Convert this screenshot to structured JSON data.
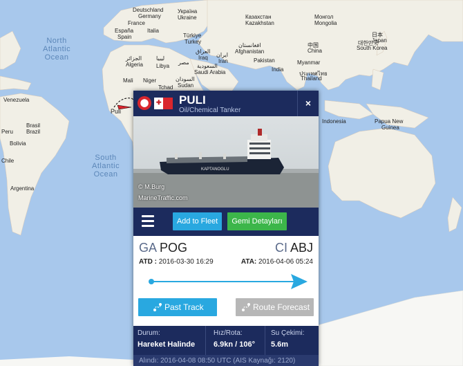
{
  "map": {
    "oceans": {
      "north_atlantic_1": "North",
      "north_atlantic_2": "Atlantic",
      "north_atlantic_3": "Ocean",
      "south_atlantic_1": "South",
      "south_atlantic_2": "Atlantic",
      "south_atlantic_3": "Ocean"
    },
    "countries": {
      "deutschland": "Deutschland",
      "germany": "Germany",
      "ukraina": "Україна",
      "ukraine": "Ukraine",
      "france": "France",
      "espana": "España",
      "spain": "Spain",
      "italia": "Italia",
      "turkiye": "Türkiye",
      "turkey": "Turkey",
      "kazakhstan_cyr": "Казахстан",
      "kazakhstan": "Kazakhstan",
      "mongolia_cyr": "Монгол",
      "mongolia": "Mongolia",
      "china_cjk": "中国",
      "china": "China",
      "japan_cjk": "日本",
      "japan": "Japan",
      "korea_1": "대한민국",
      "korea_2": "South Korea",
      "afghanistan_ar": "افغانستان",
      "afghanistan": "Afghanistan",
      "iraq_ar": "العراق",
      "iraq": "Iraq",
      "iran_ar": "ایران",
      "iran": "Iran",
      "saudi_ar": "السعودية",
      "saudi": "Saudi Arabia",
      "pakistan": "Pakistan",
      "india": "India",
      "myanmar": "Myanmar",
      "thailand_th": "ประเทศไทย",
      "thailand": "Thailand",
      "libya_ar": "ليبيا",
      "libya": "Libya",
      "algeria_ar": "الجزائر",
      "algeria": "Algeria",
      "egypt": "مصر",
      "mali": "Mali",
      "niger": "Niger",
      "tchad": "Tchad",
      "sudan_ar": "السودان",
      "sudan": "Sudan",
      "venezuela": "Venezuela",
      "brasil": "Brasil",
      "brazil": "Brazil",
      "peru": "Peru",
      "bolivia": "Bolivia",
      "chile": "Chile",
      "argentina": "Argentina",
      "indonesia": "Indonesia",
      "png_1": "Papua New",
      "png_2": "Guinea",
      "ship_label": "Puli"
    }
  },
  "popup": {
    "ship_name": "PULI",
    "ship_type": "Oil/Chemical Tanker",
    "close_glyph": "×",
    "photo_credit": "© M.Burg",
    "photo_watermark": "MarineTraffic.com",
    "hull_text": "KAPTANOGLU",
    "buttons": {
      "add_to_fleet": "Add to Fleet",
      "details": "Gemi Detayları",
      "past_track": "Past Track",
      "route_forecast": "Route Forecast"
    },
    "origin": {
      "country": "GA",
      "port": "POG"
    },
    "destination": {
      "country": "CI",
      "port": "ABJ"
    },
    "atd_label": "ATD :",
    "atd_value": "2016-03-30 16:29",
    "ata_label": "ATA:",
    "ata_value": "2016-04-06 05:24",
    "progress": 1.0,
    "info": {
      "status_label": "Durum:",
      "status_value": "Hareket Halinde",
      "speed_label": "Hız/Rota:",
      "speed_value": "6.9kn / 106°",
      "draught_label": "Su Çekimi:",
      "draught_value": "5.6m"
    },
    "received_label": "Alındı:",
    "received_value": "2016-04-08 08:50 UTC",
    "received_source": "(AIS Kaynağı: 2120)"
  },
  "colors": {
    "header": "#1c2b5d",
    "blue_button": "#29a8e0",
    "green_button": "#3cb64a",
    "gray_button": "#b7b7b7",
    "ocean": "#a8c8ec",
    "land": "#f1efe6"
  }
}
